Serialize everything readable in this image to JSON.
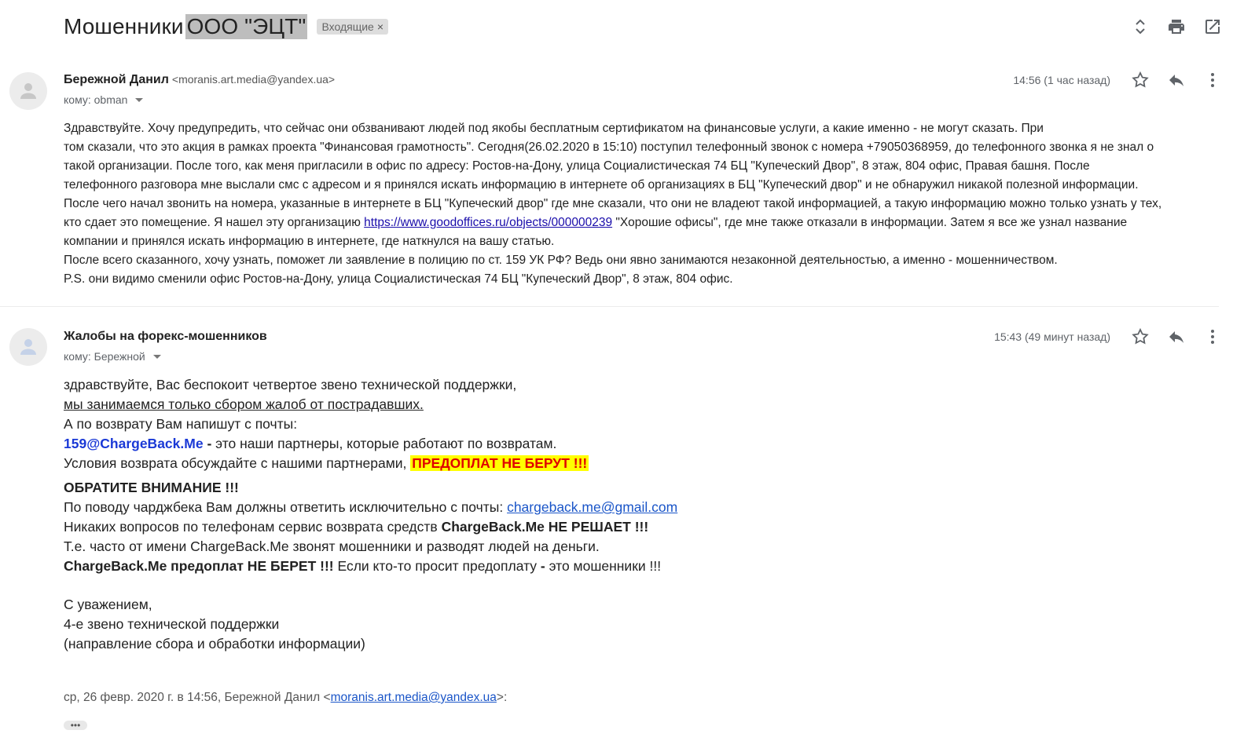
{
  "subject": {
    "prefix": "Мошенники",
    "highlighted": "ООО \"ЭЦТ\"",
    "label": "Входящие",
    "label_close": "×"
  },
  "top_actions": [
    "expand-collapse-icon",
    "print-icon",
    "open-new-window-icon"
  ],
  "message1": {
    "sender_name": "Бережной Данил",
    "sender_email": "<moranis.art.media@yandex.ua>",
    "to": "кому: obman",
    "time": "14:56 (1 час назад)",
    "lines": [
      "Здравствуйте. Хочу предупредить, что сейчас они обзванивают людей под якобы бесплатным сертификатом на финансовые услуги, а какие именно - не могут сказать. При",
      "том сказали, что это акция в рамках проекта \"Финансовая грамотность\". Сегодня(26.02.2020 в 15:10) поступил телефонный звонок с номера +79050368959, до телефонного звонка я не знал о",
      "такой организации. После того, как меня пригласили в офис по адресу: Ростов-на-Дону, улица Социалистическая 74 БЦ \"Купеческий Двор\", 8 этаж, 804 офис, Правая башня. После",
      "телефонного разговора мне выслали смс с адресом и я принялся искать информацию в интернете об организациях в БЦ \"Купеческий двор\" и не обнаружил никакой полезной информации.",
      "После чего начал звонить на номера, указанные в интернете в БЦ \"Купеческий двор\" где мне сказали, что они не владеют такой информацией, а такую информацию можно только узнать у тех,"
    ],
    "line6_before": "кто сдает это помещение. Я нашел эту организацию ",
    "line6_link": "https://www.goodoffices.ru/objects/000000239",
    "line6_after": " \"Хорошие офисы\", где мне также отказали в информации. Затем я все же узнал название",
    "lines_end": [
      "компании и принялся искать информацию в интернете, где наткнулся на вашу статью.",
      "После всего сказанного, хочу узнать, поможет ли заявление в полицию по ст. 159 УК РФ? Ведь они явно занимаются незаконной деятельностью, а именно - мошенничеством.",
      "P.S. они видимо сменили офис Ростов-на-Дону, улица Социалистическая 74 БЦ \"Купеческий Двор\", 8 этаж, 804 офис."
    ]
  },
  "message2": {
    "sender_name": "Жалобы на форекс-мошенников",
    "to": "кому: Бережной",
    "time": "15:43 (49 минут назад)",
    "l1": "здравствуйте, Вас беспокоит четвертое звено технической поддержки,",
    "l2": "мы занимаемся только сбором жалоб от пострадавших.",
    "l3": "А по возврату Вам напишут с почты:",
    "l4_email": "159@ChargeBack.Me",
    "l4_dash": " -",
    "l4_rest": " это наши партнеры, которые работают по возвратам.",
    "l5_text": "Условия возврата обсуждайте с нашими партнерами, ",
    "l5_hl": "ПРЕДОПЛАТ НЕ БЕРУТ !!!",
    "l6": "ОБРАТИТЕ ВНИМАНИЕ !!!",
    "l7_text": "По поводу чарджбека Вам должны ответить исключительно с почты: ",
    "l7_link": "chargeback.me@gmail.com",
    "l8_text": "Никаких вопросов по телефонам сервис возврата средств ",
    "l8_bold": "ChargeBack.Me НЕ РЕШАЕТ !!!",
    "l9": "Т.е. часто от имени ChargeBack.Me звонят мошенники и разводят людей на деньги.",
    "l10_bold": "ChargeBack.Me предоплат НЕ БЕРЕТ !!!",
    "l10_text": " Если кто-то просит предоплату ",
    "l10_dash": "-",
    "l10_end": " это мошенники !!!",
    "sig1": "С уважением,",
    "sig2": "4-е звено технической поддержки",
    "sig3": "(направление сбора и обработки информации)",
    "quote_text": "ср, 26 февр. 2020 г. в 14:56, Бережной Данил <",
    "quote_link": "moranis.art.media@yandex.ua",
    "quote_end": ">:",
    "dots": "•••"
  }
}
